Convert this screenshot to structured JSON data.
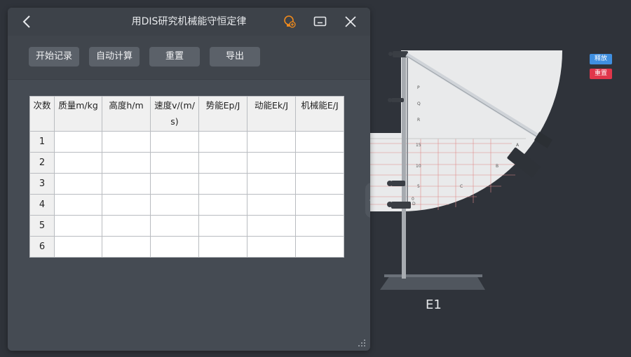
{
  "window": {
    "title": "用DIS研究机械能守恒定律"
  },
  "toolbar": {
    "start_label": "开始记录",
    "auto_calc_label": "自动计算",
    "reset_label": "重置",
    "export_label": "导出"
  },
  "table": {
    "headers": [
      "次数",
      "质量m/kg",
      "高度h/m",
      "速度v/(m/s)",
      "势能Ep/J",
      "动能Ek/J",
      "机械能E/J"
    ],
    "rows": [
      {
        "index": "1",
        "cells": [
          "",
          "",
          "",
          "",
          "",
          ""
        ]
      },
      {
        "index": "2",
        "cells": [
          "",
          "",
          "",
          "",
          "",
          ""
        ]
      },
      {
        "index": "3",
        "cells": [
          "",
          "",
          "",
          "",
          "",
          ""
        ]
      },
      {
        "index": "4",
        "cells": [
          "",
          "",
          "",
          "",
          "",
          ""
        ]
      },
      {
        "index": "5",
        "cells": [
          "",
          "",
          "",
          "",
          "",
          ""
        ]
      },
      {
        "index": "6",
        "cells": [
          "",
          "",
          "",
          "",
          "",
          ""
        ]
      }
    ]
  },
  "scene": {
    "release_label": "释放",
    "reset_label": "重置",
    "energy_label": "E1",
    "board_marks": [
      "P",
      "Q",
      "R",
      "15",
      "10",
      "5",
      "0",
      "A",
      "B",
      "C",
      "D"
    ]
  },
  "colors": {
    "background": "#2f333a",
    "panel": "#454b53",
    "toolbar_button": "#5b6169",
    "release_button": "#3f8fe0",
    "reset_button": "#e0364a",
    "lightbulb_icon": "#f08a1c"
  }
}
